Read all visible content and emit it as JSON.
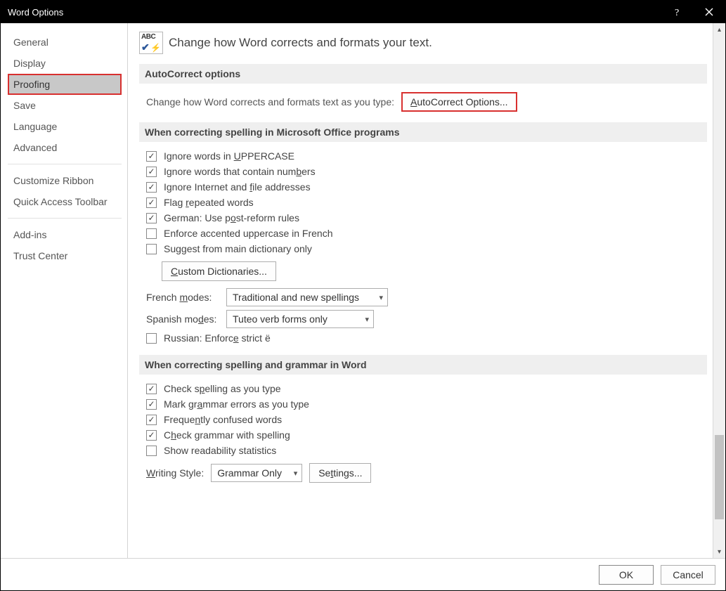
{
  "titlebar": {
    "title": "Word Options"
  },
  "sidebar": {
    "groups": [
      [
        "General",
        "Display",
        "Proofing",
        "Save",
        "Language",
        "Advanced"
      ],
      [
        "Customize Ribbon",
        "Quick Access Toolbar"
      ],
      [
        "Add-ins",
        "Trust Center"
      ]
    ],
    "selected": "Proofing"
  },
  "header": {
    "title": "Change how Word corrects and formats your text."
  },
  "sections": {
    "autocorrect": {
      "title": "AutoCorrect options",
      "desc": "Change how Word corrects and formats text as you type:",
      "button": "AutoCorrect Options..."
    },
    "office_spelling": {
      "title": "When correcting spelling in Microsoft Office programs",
      "checks": [
        {
          "label": "Ignore words in UPPERCASE",
          "checked": true,
          "u": "U"
        },
        {
          "label": "Ignore words that contain numbers",
          "checked": true,
          "u": "b"
        },
        {
          "label": "Ignore Internet and file addresses",
          "checked": true,
          "u": "f"
        },
        {
          "label": "Flag repeated words",
          "checked": true,
          "u": "r"
        },
        {
          "label": "German: Use post-reform rules",
          "checked": true,
          "u": "o"
        },
        {
          "label": "Enforce accented uppercase in French",
          "checked": false
        },
        {
          "label": "Suggest from main dictionary only",
          "checked": false
        }
      ],
      "custom_dict_btn": "Custom Dictionaries...",
      "french_label": "French modes:",
      "french_value": "Traditional and new spellings",
      "spanish_label": "Spanish modes:",
      "spanish_value": "Tuteo verb forms only",
      "russian": {
        "label": "Russian: Enforce strict ё",
        "checked": false,
        "u": "e"
      }
    },
    "word_spelling": {
      "title": "When correcting spelling and grammar in Word",
      "checks": [
        {
          "label": "Check spelling as you type",
          "checked": true,
          "u": "p"
        },
        {
          "label": "Mark grammar errors as you type",
          "checked": true,
          "u": "a"
        },
        {
          "label": "Frequently confused words",
          "checked": true,
          "u": "n"
        },
        {
          "label": "Check grammar with spelling",
          "checked": true,
          "u": "h"
        },
        {
          "label": "Show readability statistics",
          "checked": false
        }
      ],
      "writing_style_label": "Writing Style:",
      "writing_style_value": "Grammar Only",
      "settings_btn": "Settings..."
    }
  },
  "footer": {
    "ok": "OK",
    "cancel": "Cancel"
  }
}
